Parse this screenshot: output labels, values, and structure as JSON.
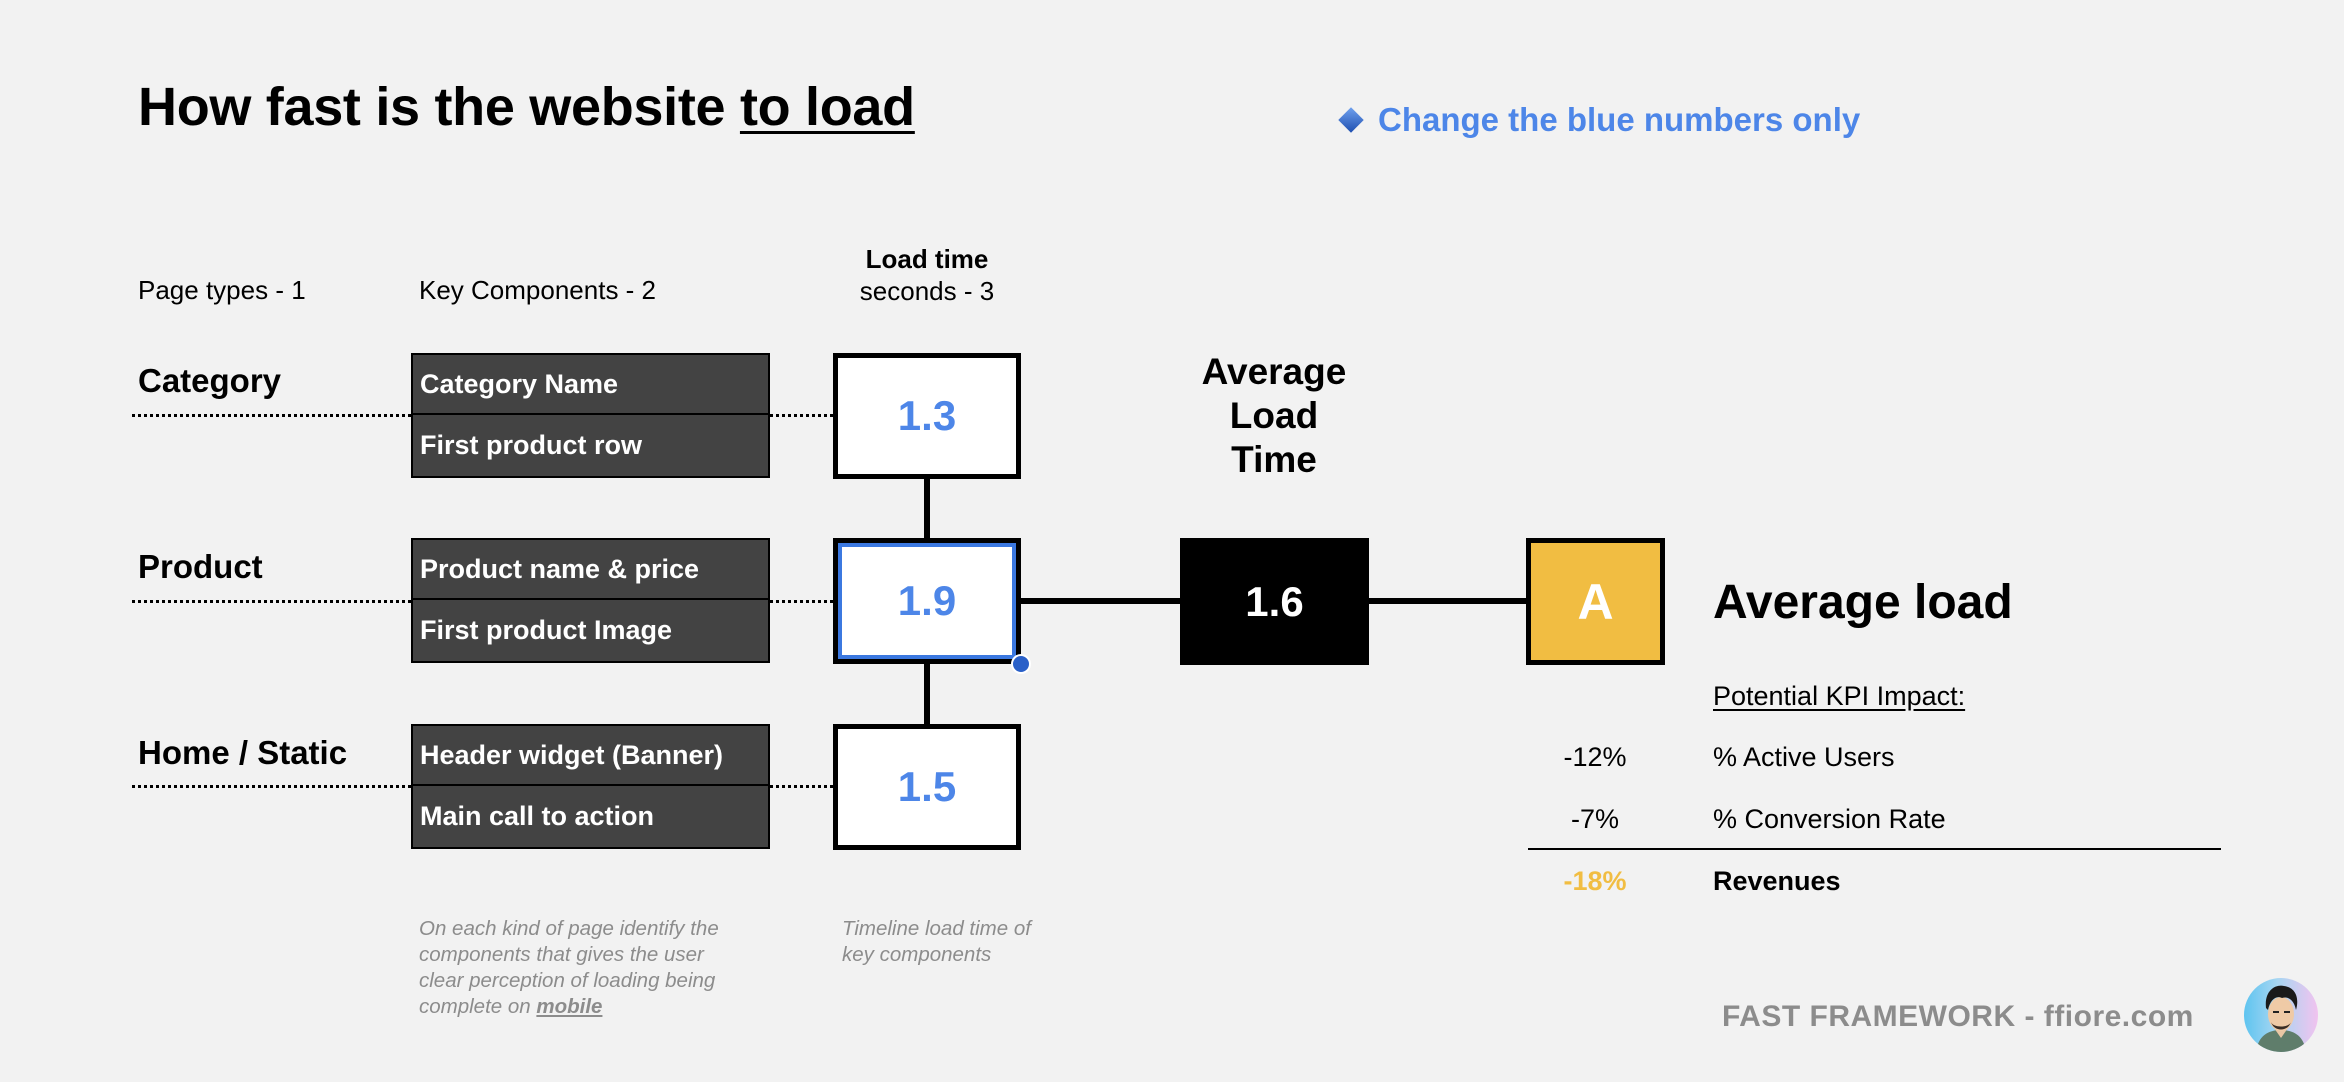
{
  "title": {
    "prefix": "How fast is the website ",
    "underlined": "to load"
  },
  "hint": {
    "icon": "diamond-icon",
    "text": "Change the blue numbers only",
    "color": "#4d86e8"
  },
  "columns": {
    "page_types": "Page types - 1",
    "key_components": "Key Components - 2",
    "load_time_title": "Load time",
    "load_time_sub": "seconds - 3"
  },
  "rows": [
    {
      "page": "Category",
      "components": [
        "Category Name",
        "First product row"
      ],
      "load_time": "1.3"
    },
    {
      "page": "Product",
      "components": [
        "Product name & price",
        "First product Image"
      ],
      "load_time": "1.9"
    },
    {
      "page": "Home / Static",
      "components": [
        "Header widget (Banner)",
        "Main call to action"
      ],
      "load_time": "1.5"
    }
  ],
  "average": {
    "heading": [
      "Average",
      "Load",
      "Time"
    ],
    "value": "1.6"
  },
  "grade": {
    "letter": "A",
    "label": "Average load",
    "color": "#f1bd42"
  },
  "kpi": {
    "heading": "Potential KPI Impact:",
    "items": [
      {
        "value": "-12%",
        "label": "% Active Users"
      },
      {
        "value": "-7%",
        "label": "% Conversion Rate"
      }
    ],
    "total": {
      "value": "-18%",
      "label": "Revenues",
      "color": "#f1bd42"
    }
  },
  "notes": {
    "components": [
      "On each kind of page identify the",
      "components that gives the user",
      "clear perception of loading being",
      "complete on "
    ],
    "components_emphasis": "mobile",
    "timeline": [
      "Timeline load time of",
      "key components"
    ]
  },
  "footer": {
    "text": "FAST FRAMEWORK - ffiore.com",
    "avatar": "author-avatar"
  }
}
